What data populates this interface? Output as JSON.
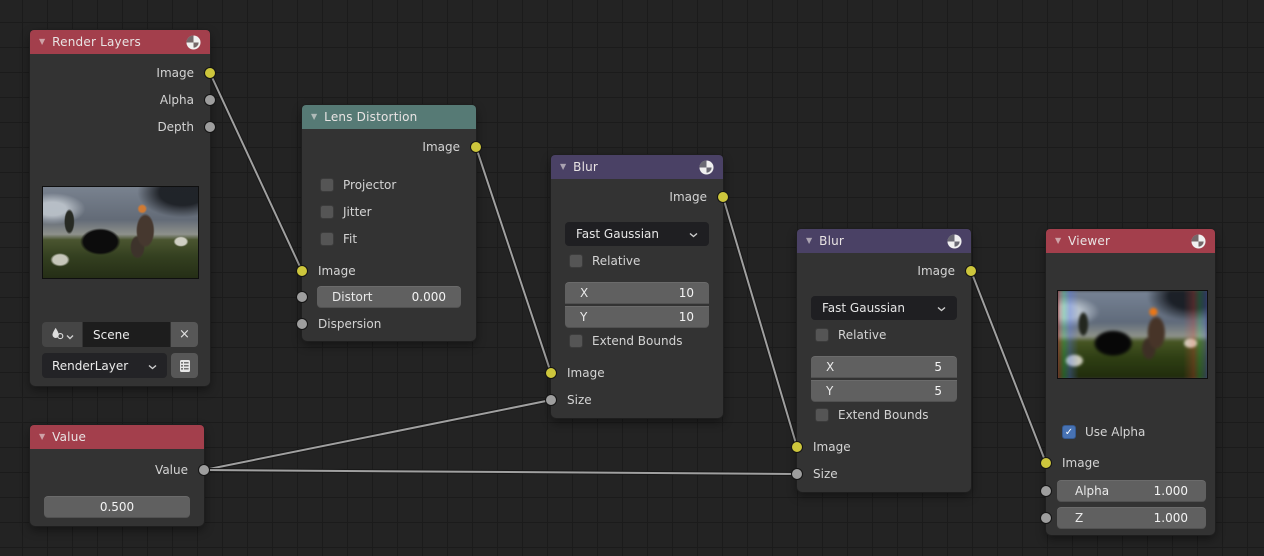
{
  "nodes": {
    "render_layers": {
      "title": "Render Layers",
      "outputs": [
        {
          "label": "Image"
        },
        {
          "label": "Alpha"
        },
        {
          "label": "Depth"
        }
      ],
      "scene_field": {
        "value": "Scene"
      },
      "layer_field": {
        "value": "RenderLayer"
      }
    },
    "lens_distortion": {
      "title": "Lens Distortion",
      "outputs": [
        {
          "label": "Image"
        }
      ],
      "options": [
        {
          "label": "Projector"
        },
        {
          "label": "Jitter"
        },
        {
          "label": "Fit"
        }
      ],
      "inputs": [
        {
          "label": "Image"
        }
      ],
      "distort": {
        "label": "Distort",
        "value": "0.000"
      },
      "dispersion": {
        "label": "Dispersion"
      }
    },
    "blur_1": {
      "title": "Blur",
      "outputs": [
        {
          "label": "Image"
        }
      ],
      "filter_type": "Fast Gaussian",
      "relative_label": "Relative",
      "x": {
        "label": "X",
        "value": "10"
      },
      "y": {
        "label": "Y",
        "value": "10"
      },
      "extend_bounds_label": "Extend Bounds",
      "inputs": [
        {
          "label": "Image"
        },
        {
          "label": "Size"
        }
      ]
    },
    "blur_2": {
      "title": "Blur",
      "outputs": [
        {
          "label": "Image"
        }
      ],
      "filter_type": "Fast Gaussian",
      "relative_label": "Relative",
      "x": {
        "label": "X",
        "value": "5"
      },
      "y": {
        "label": "Y",
        "value": "5"
      },
      "extend_bounds_label": "Extend Bounds",
      "inputs": [
        {
          "label": "Image"
        },
        {
          "label": "Size"
        }
      ]
    },
    "viewer": {
      "title": "Viewer",
      "use_alpha_label": "Use Alpha",
      "use_alpha_checked": true,
      "inputs": [
        {
          "label": "Image"
        }
      ],
      "alpha": {
        "label": "Alpha",
        "value": "1.000"
      },
      "z": {
        "label": "Z",
        "value": "1.000"
      }
    },
    "value": {
      "title": "Value",
      "outputs": [
        {
          "label": "Value"
        }
      ],
      "value": "0.500"
    }
  },
  "icons": {
    "collapse": "▼",
    "close": "×",
    "check": "✓"
  },
  "colors": {
    "header_red": "#a33f4c",
    "header_teal": "#567a75",
    "header_purple": "#4a4165",
    "node_body": "#333333",
    "canvas_bg": "#232323",
    "socket_image": "#cdc63c",
    "socket_value": "#9e9e9e",
    "checkbox_checked": "#4772b3",
    "wire": "#a0a0a0"
  }
}
